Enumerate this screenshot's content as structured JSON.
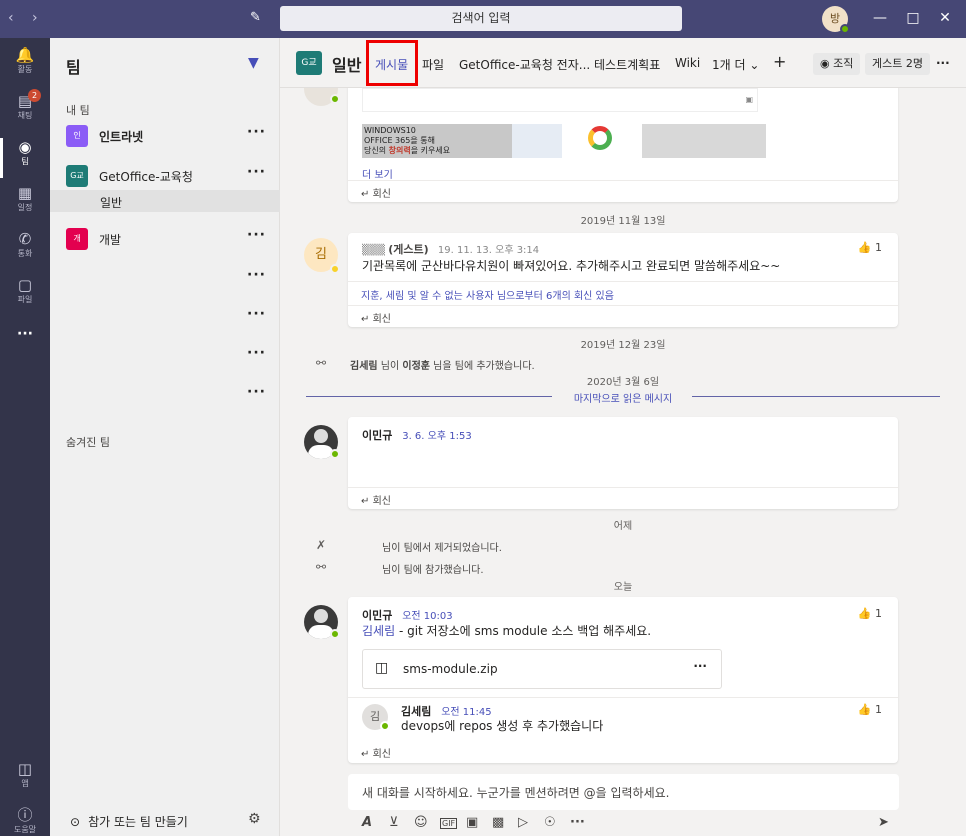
{
  "app": {
    "search_placeholder": "검색어 입력",
    "user_initial": "방"
  },
  "rail": [
    {
      "label": "활동",
      "icon": "bell-icon"
    },
    {
      "label": "채팅",
      "icon": "chat-icon",
      "badge": "2"
    },
    {
      "label": "팀",
      "icon": "teams-icon",
      "active": true
    },
    {
      "label": "일정",
      "icon": "calendar-icon"
    },
    {
      "label": "통화",
      "icon": "phone-icon"
    },
    {
      "label": "파일",
      "icon": "file-icon"
    },
    {
      "label": "···",
      "icon": "more-icon"
    },
    {
      "label": "앱",
      "icon": "apps-icon"
    },
    {
      "label": "도움말",
      "icon": "help-icon"
    }
  ],
  "sidebar": {
    "title": "팀",
    "my_teams_label": "내 팀",
    "teams": [
      {
        "tile": "인",
        "name": "인트라넷",
        "color": "#8b5cf6"
      },
      {
        "tile": "G교",
        "name": "GetOffice-교육청",
        "color": "#1e7b76"
      },
      {
        "tile": "개",
        "name": "개발",
        "color": "#e3004f"
      }
    ],
    "channel": "일반",
    "hidden_teams_label": "숨겨진 팀",
    "join_create": "참가 또는 팀 만들기"
  },
  "header": {
    "tile": "G교",
    "title": "일반",
    "tabs": [
      "게시물",
      "파일",
      "GetOffice-교육청 전자...",
      "테스트계획표",
      "Wiki",
      "1개 더"
    ],
    "org_label": "조직",
    "guests_label": "게스트 2명"
  },
  "feed": {
    "preview": {
      "banner_line1": "WINDOWS10",
      "banner_line2": "OFFICE 365을 통해",
      "banner_line3_pre": "당신의 ",
      "banner_line3_em": "창의력",
      "banner_line3_post": "을 키우세요",
      "see_more": "더 보기",
      "reply": "회신"
    },
    "date1": "2019년 11월 13일",
    "msg1": {
      "avatar": "김",
      "author": "(게스트)",
      "time": "19. 11. 13. 오후 3:14",
      "text": "기관목록에 군산바다유치원이 빠져있어요. 추가해주시고 완료되면 말씀해주세요~~",
      "likes": "1",
      "thread": "지훈, 세림 및 알 수 없는 사용자 님으로부터 6개의 회신 있음",
      "reply": "회신"
    },
    "date2": "2019년 12월 23일",
    "sys1": {
      "actor": "김세림",
      "mid": " 님이 ",
      "target": "이정훈",
      "tail": " 님을 팀에 추가했습니다."
    },
    "date3": "2020년 3월 6일",
    "last_read": "마지막으로 읽은 메시지",
    "msg2": {
      "author": "이민규",
      "time": "3. 6. 오후 1:53",
      "reply": "회신"
    },
    "date4": "어제",
    "sys2": "님이 팀에서 제거되었습니다.",
    "sys3": "님이 팀에 참가했습니다.",
    "date5": "오늘",
    "msg3": {
      "author": "이민규",
      "time": "오전 10:03",
      "mention": "김세림",
      "text": " - git 저장소에 sms module 소스 백업 해주세요.",
      "likes": "1",
      "file": "sms-module.zip",
      "sub_avatar": "김",
      "sub_author": "김세림",
      "sub_time": "오전 11:45",
      "sub_text": "devops에 repos 생성 후 추가했습니다",
      "sub_likes": "1",
      "reply": "회신"
    }
  },
  "compose": {
    "placeholder": "새 대화를 시작하세요. 누군가를 멘션하려면 @을 입력하세요."
  }
}
